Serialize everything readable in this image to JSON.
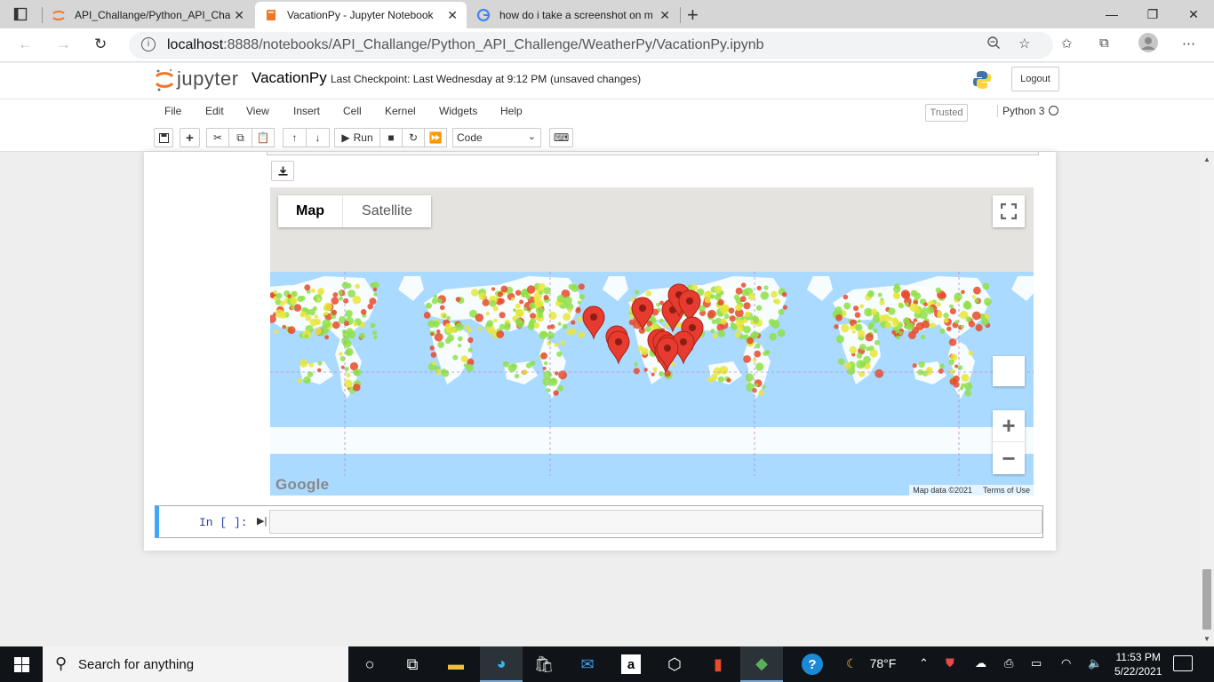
{
  "browser": {
    "tabs": [
      {
        "label": "API_Challange/Python_API_Challe",
        "icon": "jupyter-favicon",
        "active": false
      },
      {
        "label": "VacationPy - Jupyter Notebook",
        "icon": "notebook-favicon",
        "active": true
      },
      {
        "label": "how do i take a screenshot on m",
        "icon": "google-favicon",
        "active": false
      }
    ],
    "url_host": "localhost",
    "url_rest": ":8888/notebooks/API_Challange/Python_API_Challenge/WeatherPy/VacationPy.ipynb"
  },
  "jupyter": {
    "logo_text": "jupyter",
    "notebook_name": "VacationPy",
    "checkpoint": "Last Checkpoint: Last Wednesday at 9:12 PM",
    "unsaved": "(unsaved changes)",
    "logout_label": "Logout",
    "menu": [
      "File",
      "Edit",
      "View",
      "Insert",
      "Cell",
      "Kernel",
      "Widgets",
      "Help"
    ],
    "trusted_label": "Trusted",
    "kernel_name": "Python 3",
    "run_label": "Run",
    "cell_type": "Code"
  },
  "map": {
    "map_label": "Map",
    "satellite_label": "Satellite",
    "google_logo": "Google",
    "map_data": "Map data ©2021",
    "terms": "Terms of Use",
    "zoom_in": "+",
    "zoom_out": "−",
    "ocean_color": "#aadaff",
    "land_color": "#ffffff"
  },
  "cell": {
    "prompt": "In [ ]:"
  },
  "taskbar": {
    "search_placeholder": "Search for anything",
    "weather": "78°F",
    "time": "11:53 PM",
    "date": "5/22/2021"
  }
}
